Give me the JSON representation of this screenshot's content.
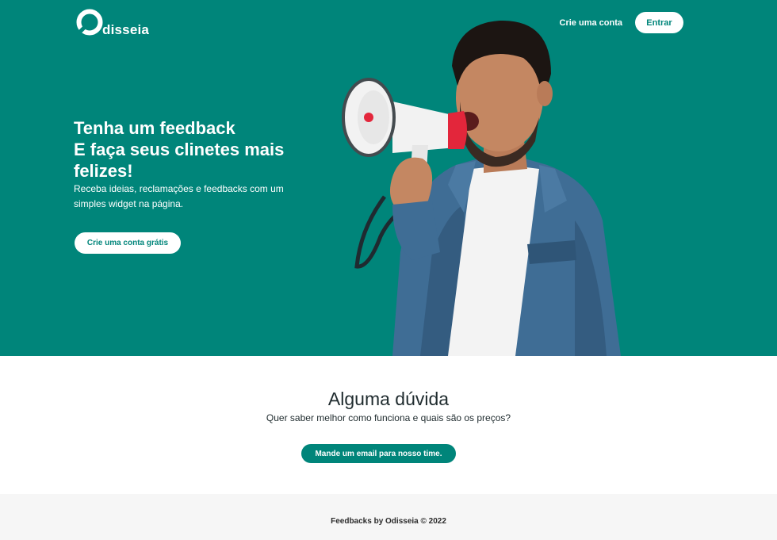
{
  "brand": {
    "name": "Odisseia",
    "logo_text": "disseia",
    "color": "#00857a"
  },
  "nav": {
    "signup_link": "Crie uma conta",
    "login_button": "Entrar"
  },
  "hero": {
    "title_lines": [
      "Tenha um feedback",
      "E faça seus clinetes mais felizes!"
    ],
    "subtitle": "Receba ideias, reclamações e feedbacks com um simples widget na página.",
    "cta": "Crie uma conta grátis",
    "photo_icon": "man-with-megaphone-photo"
  },
  "faq": {
    "title": "Alguma dúvida",
    "subtitle": "Quer saber melhor como funciona e quais são os preços?",
    "button": "Mande um email para nosso time."
  },
  "footer": {
    "text": "Feedbacks by Odisseia © 2022"
  }
}
